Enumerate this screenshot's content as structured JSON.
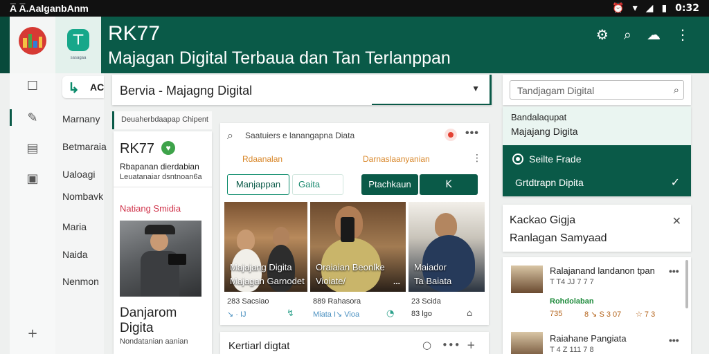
{
  "status_bar": {
    "left_text": "A̅ A̅.AalganbAnm",
    "time": "0:32",
    "icons": [
      "alarm-icon",
      "wifi-icon",
      "signal-icon",
      "battery-icon"
    ]
  },
  "app_bar": {
    "title": "RK77",
    "subtitle": "Majagan Digital Terbaua dan Tan Terlanppan",
    "logo_caption": "sasagaa",
    "actions": [
      "settings-icon",
      "search-icon",
      "chat-icon",
      "more-vert-icon"
    ]
  },
  "rail": {
    "icons": [
      "square-icon",
      "feather-icon",
      "calendar-icon",
      "phone-icon",
      "add-icon"
    ]
  },
  "nav": {
    "chip_label": "AC",
    "items": [
      "Marnany",
      "Betmaraia",
      "Ualoagi",
      "Nombavk",
      "Maria",
      "Naida",
      "Nenmon"
    ]
  },
  "dropdown": {
    "value": "Bervia - Majagng Digital"
  },
  "left_column": {
    "section_header": "Deuaherbdaapap Chipent",
    "profile_name": "RK77",
    "profile_desc": "Rbapanan dierdabian",
    "profile_desc2": "Leuatanaiar dsntnoan6a",
    "label": "Natiang Smidia",
    "footer_title": "Danjarom Digita",
    "footer_sub": "Nondatanian aanian"
  },
  "center_card": {
    "search_text": "Saatuiers e lanangapna Diata",
    "section_left": "Rdaanalan",
    "section_right": "Darnaslaanyanian",
    "tab_outlined": "Manjappan",
    "tab_light": "Gaita",
    "button_primary": "Ptachkaun",
    "button_icon": "K",
    "photos": [
      {
        "caption1": "Majajang Digita",
        "caption2": "Majagan Garnodet"
      },
      {
        "caption1": "Oraiaian Beonlke",
        "caption2": "Vioiate/",
        "more": "..."
      },
      {
        "caption1": "Maiador",
        "caption2": "Ta Baiata"
      }
    ],
    "stats": [
      "283 Sacsiao",
      "889 Rahasora",
      "23 Scida"
    ],
    "meta": [
      "↘ · IJ",
      "Miata I↘ Vioa",
      "83 lgo"
    ]
  },
  "bottom_card": {
    "title": "Kertiarl digtat"
  },
  "right_column": {
    "search_placeholder": "Tandjagam Digital",
    "panel_line1": "Bandalaqupat",
    "panel_line2": "Majajang Digita",
    "option_selected": "Seilte Frade",
    "option_second": "Grtdtrapn Dipita",
    "info_title": "Kackao Gigja",
    "info_subtitle": "Ranlagan Samyaad",
    "list": [
      {
        "title": "Ralajanand landanon tpan",
        "sub": "T T4 JJ 7 7 7",
        "tag": "Rohdolaban",
        "n1": "735",
        "n2": "8 ↘ S 3 07",
        "n3": "☆ 7 3"
      },
      {
        "title": "Raiahane Pangiata",
        "sub": "T 4 Z 111 7 8"
      }
    ]
  }
}
